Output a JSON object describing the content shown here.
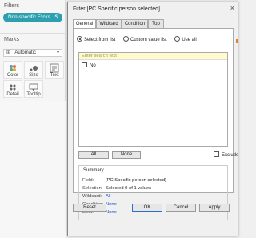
{
  "left": {
    "filters_title": "Filters",
    "filter_pill": "Non-specific F*cks",
    "filter_pill_icon": "⅋",
    "marks_title": "Marks",
    "marks_type": "Automatic",
    "marks_type_icon": "⊞",
    "mark_buttons": [
      "Color",
      "Size",
      "Text",
      "Detail",
      "Tooltip"
    ]
  },
  "dialog": {
    "title": "Filter [PC Specific person selected]",
    "close": "×",
    "tabs": [
      "General",
      "Wildcard",
      "Condition",
      "Top"
    ],
    "active_tab": "General",
    "radios": [
      "Select from list",
      "Custom value list",
      "Use all"
    ],
    "selected_radio": "Select from list",
    "search_placeholder": "Enter search text",
    "list_items": [
      "No"
    ],
    "all_button": "All",
    "none_button": "None",
    "exclude_label": "Exclude",
    "summary": {
      "title": "Summary",
      "rows": [
        {
          "label": "Field:",
          "value": "[PC Specific person selected]"
        },
        {
          "label": "Selection:",
          "value": "Selected 0 of 1 values"
        },
        {
          "label": "Wildcard:",
          "value": "All"
        },
        {
          "label": "Condition:",
          "value": "None"
        },
        {
          "label": "Limit:",
          "value": "None"
        }
      ]
    },
    "footer": {
      "reset": "Reset",
      "ok": "OK",
      "cancel": "Cancel",
      "apply": "Apply"
    }
  },
  "colors": {
    "pill": "#2d9fb0",
    "search_bg": "#fffbcc",
    "link": "#1f4fd1",
    "accent_stripe": "#e08030"
  }
}
